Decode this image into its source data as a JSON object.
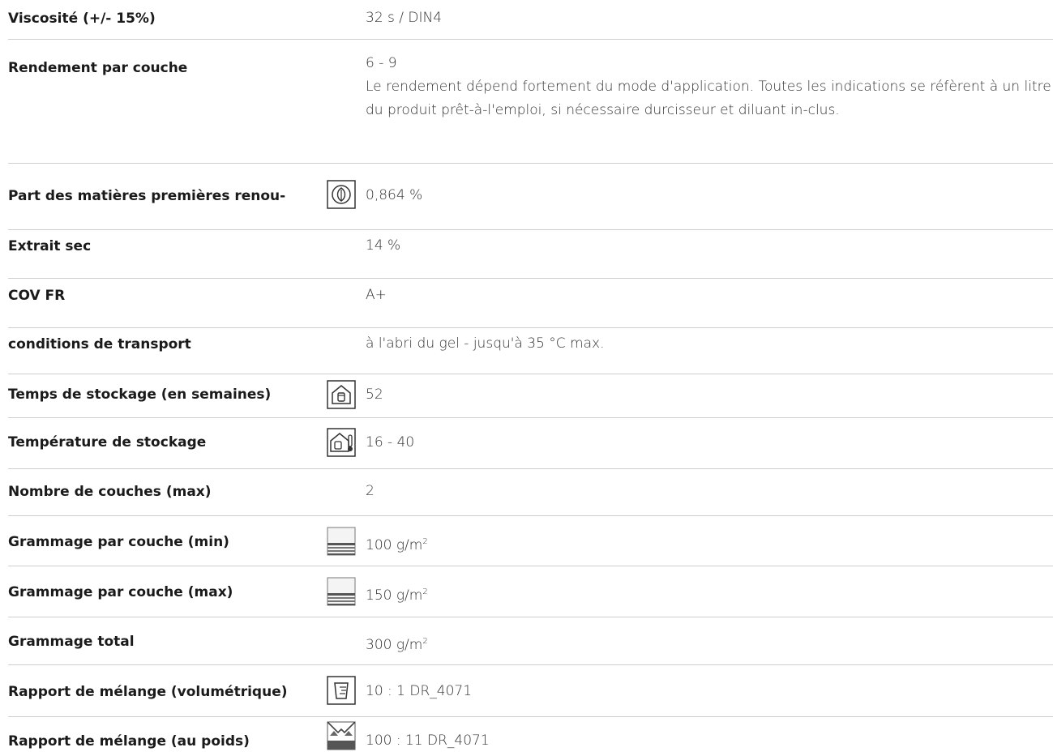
{
  "rows": [
    {
      "label": "Viscosité (+/- 15%)",
      "value": "32 s / DIN4"
    },
    {
      "label": "Rendement par couche",
      "value": "6 - 9",
      "note": "Le rendement dépend fortement du mode d'application. Toutes les indications se réfèrent à un litre du produit prêt-à-l'emploi, si nécessaire durcisseur et diluant in-clus."
    },
    {
      "label": "Part des matières premières renou-",
      "value": "0,864 %",
      "icon": "leaf-recycle-icon"
    },
    {
      "label": "Extrait sec",
      "value": "14 %"
    },
    {
      "label": "COV FR",
      "value": "A+"
    },
    {
      "label": "conditions de transport",
      "value": "à l'abri du gel - jusqu'à 35 °C max."
    },
    {
      "label": "Temps de stockage (en semaines)",
      "value": "52",
      "icon": "storage-house-icon"
    },
    {
      "label": "Température de stockage",
      "value": "16 - 40",
      "icon": "storage-temperature-icon"
    },
    {
      "label": "Nombre de couches (max)",
      "value": "2"
    },
    {
      "label": "Grammage par couche (min)",
      "value": "100 g/m",
      "sup": "2",
      "icon": "layers-icon"
    },
    {
      "label": "Grammage par couche (max)",
      "value": "150 g/m",
      "sup": "2",
      "icon": "layers-icon"
    },
    {
      "label": "Grammage total",
      "value": "300 g/m",
      "sup": "2"
    },
    {
      "label": "Rapport de mélange (volumétrique)",
      "value": "10 : 1 DR_4071",
      "icon": "measuring-cup-icon"
    },
    {
      "label": "Rapport de mélange (au poids)",
      "value": "100 : 11 DR_4071",
      "icon": "scale-icon"
    }
  ]
}
